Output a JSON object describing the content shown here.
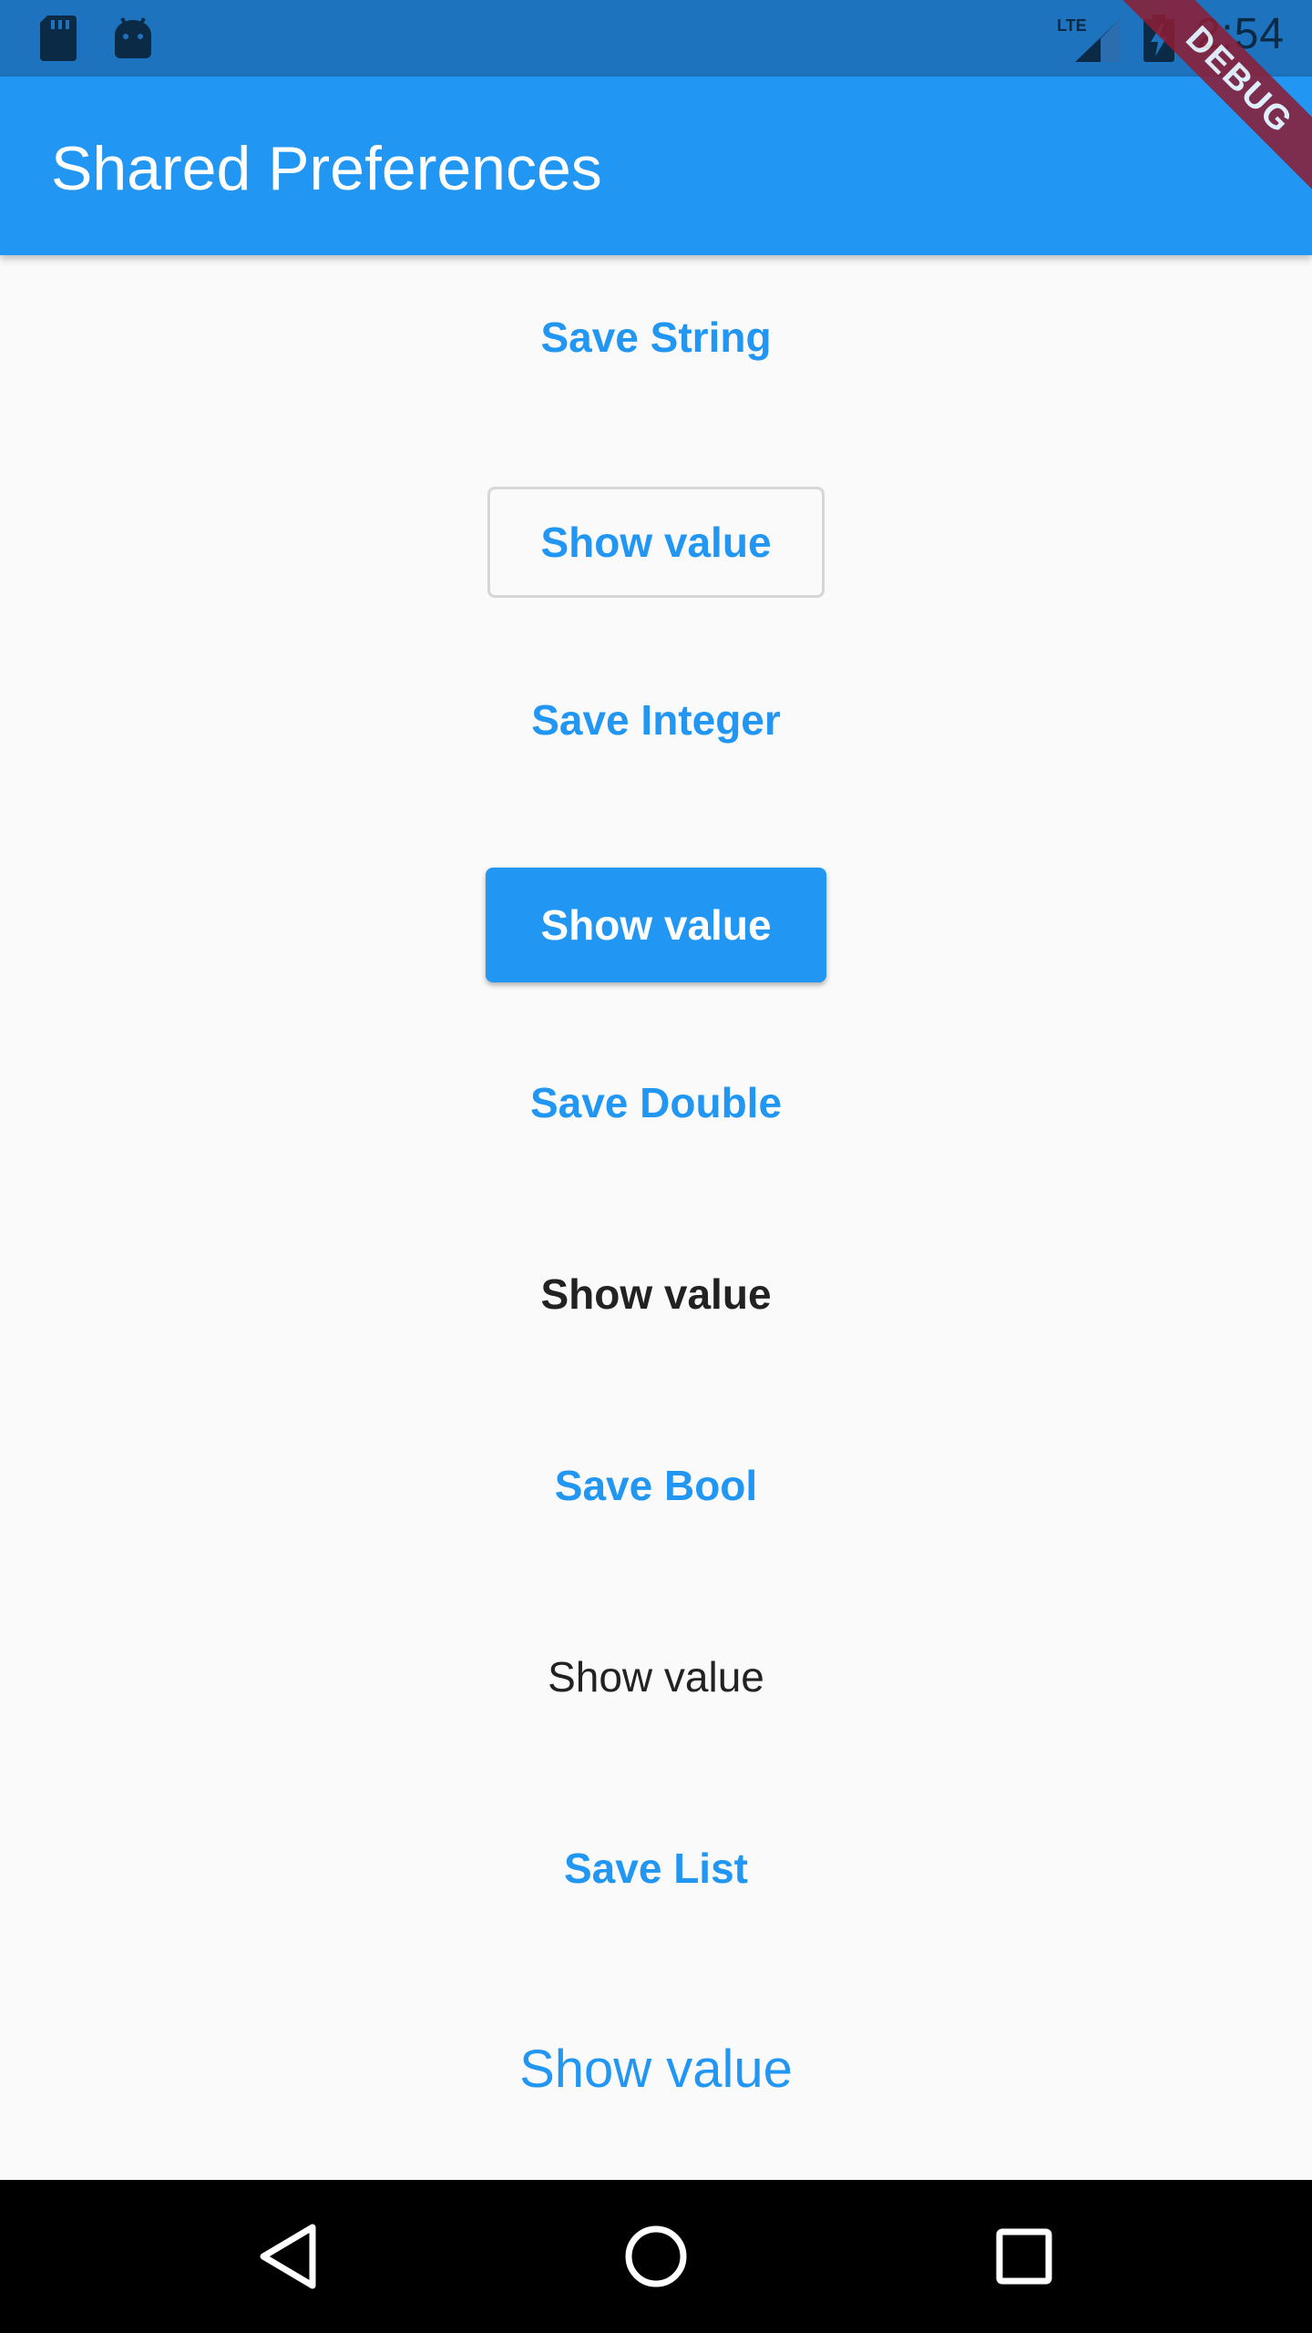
{
  "status_bar": {
    "time": "2:54",
    "network": "LTE",
    "icons": [
      "sd-card-icon",
      "android-icon",
      "lte-signal-icon",
      "battery-charging-icon"
    ]
  },
  "app_bar": {
    "title": "Shared Preferences"
  },
  "debug_banner": "DEBUG",
  "buttons": {
    "save_string": "Save String",
    "show_string": "Show value",
    "save_integer": "Save Integer",
    "show_integer": "Show value",
    "save_double": "Save Double",
    "show_double": "Show value",
    "save_bool": "Save Bool",
    "show_bool": "Show value",
    "save_list": "Save List",
    "show_list": "Show value"
  },
  "nav_bar": {
    "icons": [
      "back-icon",
      "home-icon",
      "recents-icon"
    ]
  },
  "colors": {
    "primary": "#2196f3",
    "status_bar": "#1e73be",
    "debug_banner": "#8e1d33",
    "background": "#fafafa"
  }
}
